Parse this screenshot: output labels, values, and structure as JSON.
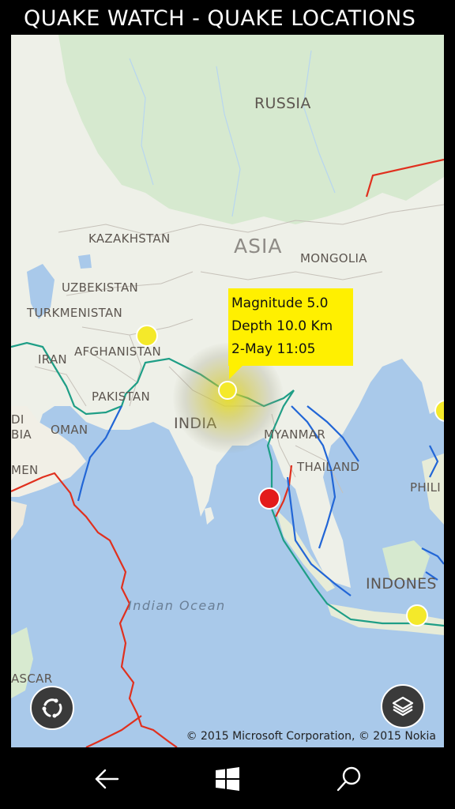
{
  "app": {
    "title": "QUAKE WATCH - QUAKE LOCATIONS"
  },
  "map": {
    "labels": {
      "russia": "RUSSIA",
      "kazakhstan": "KAZAKHSTAN",
      "asia": "ASIA",
      "mongolia": "MONGOLIA",
      "uzbekistan": "UZBEKISTAN",
      "turkmenistan": "TURKMENISTAN",
      "iran": "IRAN",
      "afghanistan": "AFGHANISTAN",
      "pakistan": "PAKISTAN",
      "india": "INDIA",
      "myanmar": "MYANMAR",
      "thailand": "THAILAND",
      "oman": "OMAN",
      "philippines_partial": "PHILI",
      "indonesia_partial": "INDONES",
      "madagascar_partial": "ASCAR",
      "yemen_partial": "MEN",
      "saudi_partial_1": "DI",
      "saudi_partial_2": "BIA",
      "indian_ocean": "Indian Ocean"
    },
    "selected_quake": {
      "magnitude": "Magnitude 5.0",
      "depth": "Depth 10.0 Km",
      "time": "2-May 11:05"
    },
    "copyright": "© 2015 Microsoft Corporation, © 2015 Nokia",
    "colors": {
      "quake_yellow": "#f4e92a",
      "quake_red": "#e31b1b",
      "callout": "#fff000",
      "plate_red": "#e0301e",
      "plate_teal": "#1e9e86",
      "plate_blue": "#2266d6"
    }
  },
  "icons": {
    "location_button": "sync-icon",
    "layers_button": "layers-icon",
    "back": "back-arrow-icon",
    "start": "windows-icon",
    "search": "search-icon"
  }
}
